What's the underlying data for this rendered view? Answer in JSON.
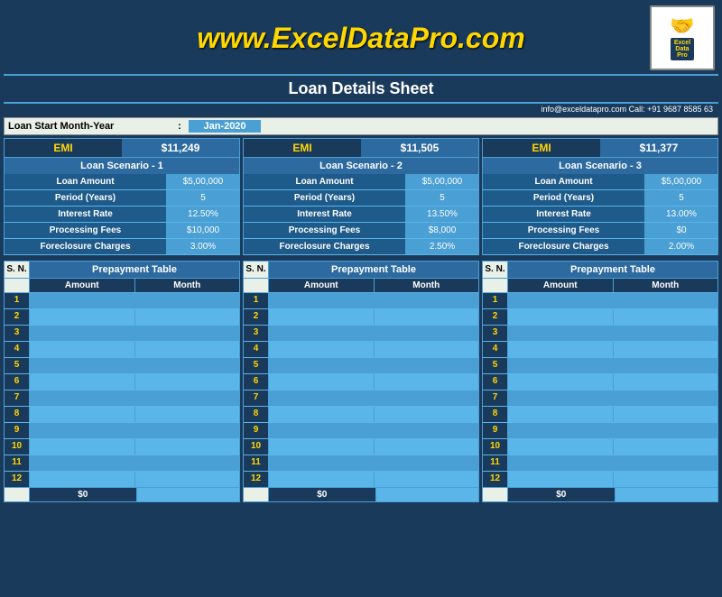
{
  "header": {
    "title": "www.ExcelDataPro.com",
    "subtitle": "Loan Details Sheet",
    "contact": "info@exceldatapro.com    Call: +91 9687 8585 63",
    "logo_text": "Excel Data Pro"
  },
  "loan_start": {
    "label": "Loan Start Month-Year",
    "colon": ":",
    "value": "Jan-2020"
  },
  "scenarios": [
    {
      "emi_label": "EMI",
      "emi_value": "$11,249",
      "scenario_label": "Loan Scenario - 1",
      "rows": [
        {
          "label": "Loan Amount",
          "value": "$5,00,000"
        },
        {
          "label": "Period (Years)",
          "value": "5"
        },
        {
          "label": "Interest Rate",
          "value": "12.50%"
        },
        {
          "label": "Processing Fees",
          "value": "$10,000"
        },
        {
          "label": "Foreclosure Charges",
          "value": "3.00%"
        }
      ],
      "prepayment": {
        "title": "Prepayment Table",
        "col1": "Amount",
        "col2": "Month",
        "total": "$0",
        "rows": [
          1,
          2,
          3,
          4,
          5,
          6,
          7,
          8,
          9,
          10,
          11,
          12
        ]
      }
    },
    {
      "emi_label": "EMI",
      "emi_value": "$11,505",
      "scenario_label": "Loan Scenario - 2",
      "rows": [
        {
          "label": "Loan Amount",
          "value": "$5,00,000"
        },
        {
          "label": "Period (Years)",
          "value": "5"
        },
        {
          "label": "Interest Rate",
          "value": "13.50%"
        },
        {
          "label": "Processing Fees",
          "value": "$8,000"
        },
        {
          "label": "Foreclosure Charges",
          "value": "2.50%"
        }
      ],
      "prepayment": {
        "title": "Prepayment Table",
        "col1": "Amount",
        "col2": "Month",
        "total": "$0",
        "rows": [
          1,
          2,
          3,
          4,
          5,
          6,
          7,
          8,
          9,
          10,
          11,
          12
        ]
      }
    },
    {
      "emi_label": "EMI",
      "emi_value": "$11,377",
      "scenario_label": "Loan Scenario - 3",
      "rows": [
        {
          "label": "Loan Amount",
          "value": "$5,00,000"
        },
        {
          "label": "Period (Years)",
          "value": "5"
        },
        {
          "label": "Interest Rate",
          "value": "13.00%"
        },
        {
          "label": "Processing Fees",
          "value": "$0"
        },
        {
          "label": "Foreclosure Charges",
          "value": "2.00%"
        }
      ],
      "prepayment": {
        "title": "Prepayment Table",
        "col1": "Amount",
        "col2": "Month",
        "total": "$0",
        "rows": [
          1,
          2,
          3,
          4,
          5,
          6,
          7,
          8,
          9,
          10,
          11,
          12
        ]
      }
    }
  ],
  "prepayment_sn_label": "S. N."
}
